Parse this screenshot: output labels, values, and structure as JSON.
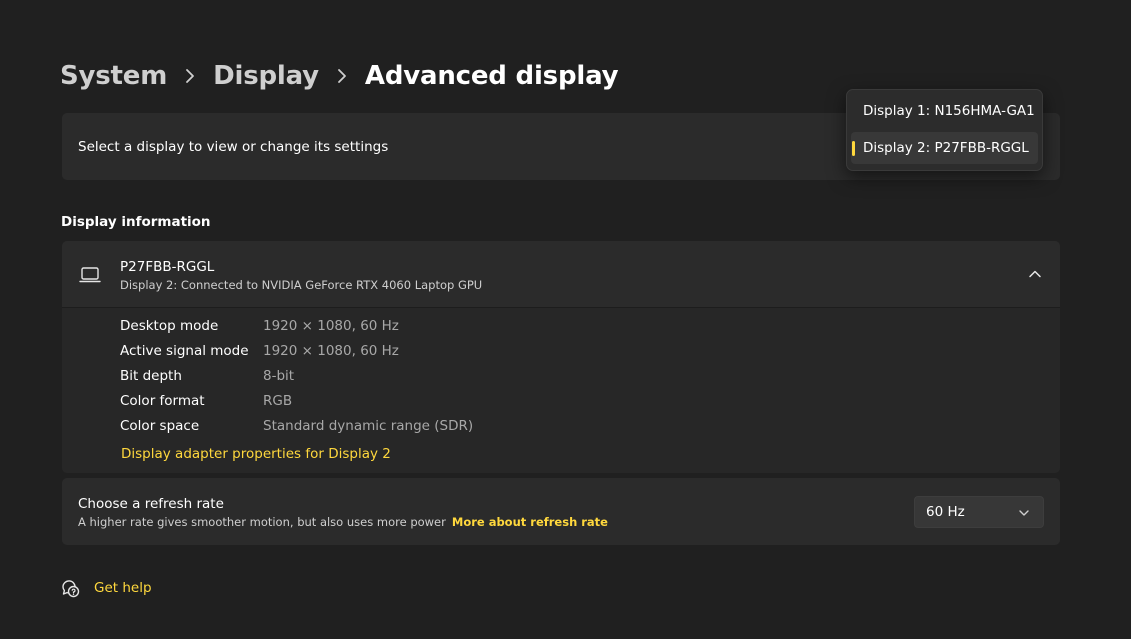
{
  "breadcrumb": {
    "items": [
      "System",
      "Display",
      "Advanced display"
    ]
  },
  "select_display": {
    "label": "Select a display to view or change its settings",
    "options": [
      "Display 1: N156HMA-GA1",
      "Display 2: P27FBB-RGGL"
    ],
    "selected": "Display 2: P27FBB-RGGL"
  },
  "display_info": {
    "section_title": "Display information",
    "name": "P27FBB-RGGL",
    "subtitle": "Display 2: Connected to NVIDIA GeForce RTX 4060 Laptop GPU",
    "rows": [
      {
        "key": "Desktop mode",
        "value": "1920 × 1080, 60 Hz"
      },
      {
        "key": "Active signal mode",
        "value": "1920 × 1080, 60 Hz"
      },
      {
        "key": "Bit depth",
        "value": "8-bit"
      },
      {
        "key": "Color format",
        "value": "RGB"
      },
      {
        "key": "Color space",
        "value": "Standard dynamic range (SDR)"
      }
    ],
    "adapter_link": "Display adapter properties for Display 2"
  },
  "refresh_rate": {
    "title": "Choose a refresh rate",
    "subtitle": "A higher rate gives smoother motion, but also uses more power",
    "link": "More about refresh rate",
    "value": "60 Hz"
  },
  "help": {
    "label": "Get help"
  },
  "colors": {
    "background": "#202020",
    "card": "#2b2b2b",
    "accent": "#ffd83d",
    "text_secondary": "#a8a8a8"
  },
  "icons": {
    "breadcrumb_separator": "chevron-right-icon",
    "display": "laptop-icon",
    "collapse": "chevron-up-icon",
    "select": "chevron-down-icon",
    "help": "help-chat-icon"
  }
}
